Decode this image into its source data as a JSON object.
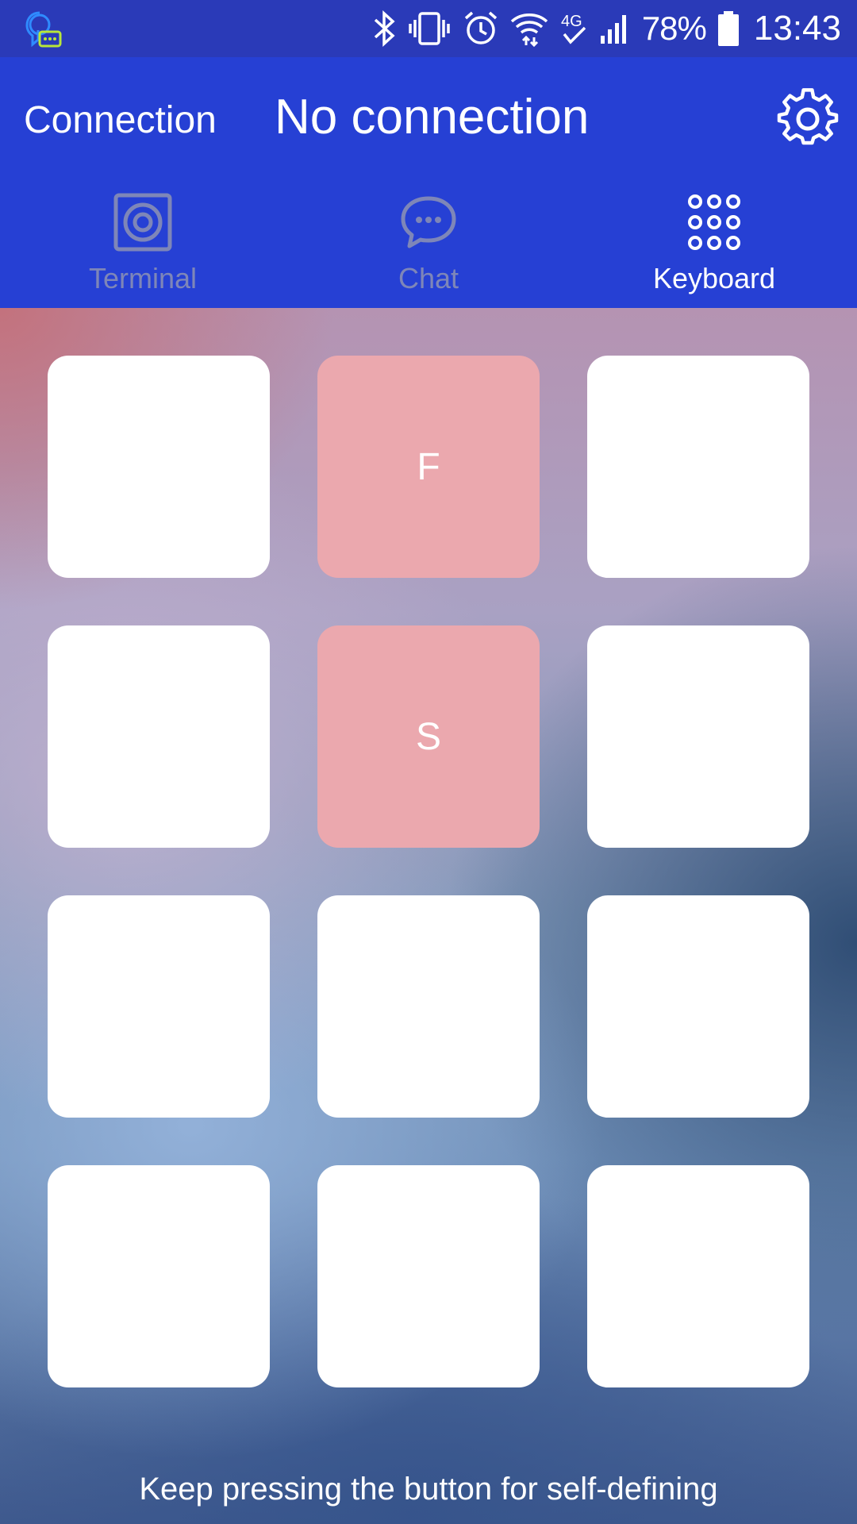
{
  "status_bar": {
    "battery_percent": "78%",
    "time": "13:43",
    "network_type": "4G",
    "icons": [
      "chat-notification-icon",
      "bluetooth-icon",
      "vibrate-icon",
      "alarm-icon",
      "wifi-icon",
      "mobile-data-icon",
      "signal-icon",
      "battery-icon"
    ]
  },
  "header": {
    "connection_label": "Connection",
    "status_text": "No connection",
    "settings_icon": "gear-icon"
  },
  "tabs": [
    {
      "label": "Terminal",
      "icon": "terminal-icon",
      "active": false
    },
    {
      "label": "Chat",
      "icon": "chat-bubble-icon",
      "active": false
    },
    {
      "label": "Keyboard",
      "icon": "keypad-icon",
      "active": true
    }
  ],
  "keys": [
    {
      "label": "",
      "color": "#ffffff"
    },
    {
      "label": "F",
      "color": "#eba8ae"
    },
    {
      "label": "",
      "color": "#ffffff"
    },
    {
      "label": "",
      "color": "#ffffff"
    },
    {
      "label": "S",
      "color": "#eba8ae"
    },
    {
      "label": "",
      "color": "#ffffff"
    },
    {
      "label": "",
      "color": "#ffffff"
    },
    {
      "label": "",
      "color": "#ffffff"
    },
    {
      "label": "",
      "color": "#ffffff"
    },
    {
      "label": "",
      "color": "#ffffff"
    },
    {
      "label": "",
      "color": "#ffffff"
    },
    {
      "label": "",
      "color": "#ffffff"
    }
  ],
  "hint": "Keep pressing the button for self-defining",
  "colors": {
    "status_bar": "#2a3ab8",
    "app_bar": "#2640d4",
    "inactive_tab": "#7e86b8",
    "key_highlight": "#eba8ae"
  }
}
